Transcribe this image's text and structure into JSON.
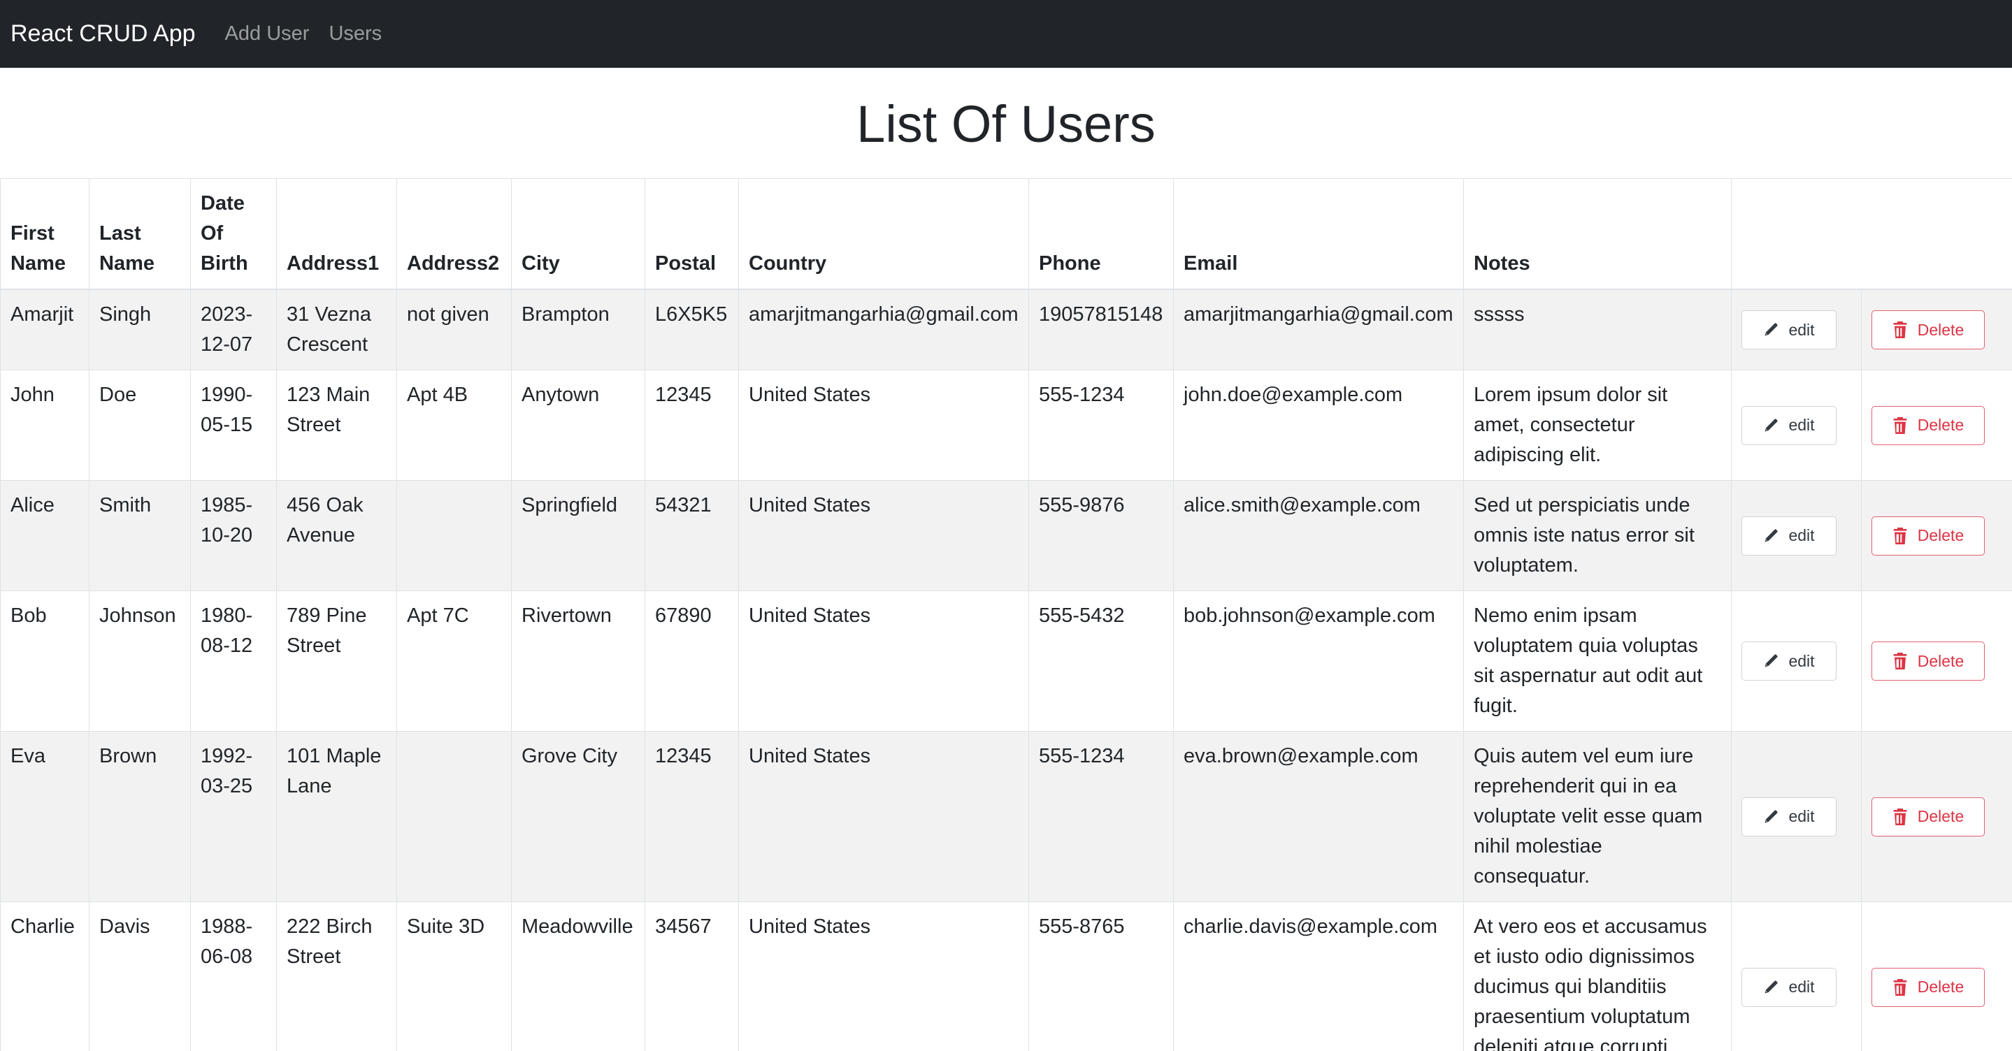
{
  "navbar": {
    "brand": "React CRUD App",
    "links": [
      "Add User",
      "Users"
    ]
  },
  "page": {
    "title": "List Of Users"
  },
  "table": {
    "headers": [
      "First Name",
      "Last Name",
      "Date Of Birth",
      "Address1",
      "Address2",
      "City",
      "Postal",
      "Country",
      "Phone",
      "Email",
      "Notes",
      ""
    ],
    "edit_label": "edit",
    "delete_label": "Delete",
    "rows": [
      {
        "first": "Amarjit",
        "last": "Singh",
        "dob": "2023-12-07",
        "address1": "31 Vezna Crescent",
        "address2": "not given",
        "city": "Brampton",
        "postal": "L6X5K5",
        "country": "amarjitmangarhia@gmail.com",
        "phone": "19057815148",
        "email": "amarjitmangarhia@gmail.com",
        "notes": "sssss"
      },
      {
        "first": "John",
        "last": "Doe",
        "dob": "1990-05-15",
        "address1": "123 Main Street",
        "address2": "Apt 4B",
        "city": "Anytown",
        "postal": "12345",
        "country": "United States",
        "phone": "555-1234",
        "email": "john.doe@example.com",
        "notes": "Lorem ipsum dolor sit amet, consectetur adipiscing elit."
      },
      {
        "first": "Alice",
        "last": "Smith",
        "dob": "1985-10-20",
        "address1": "456 Oak Avenue",
        "address2": "",
        "city": "Springfield",
        "postal": "54321",
        "country": "United States",
        "phone": "555-9876",
        "email": "alice.smith@example.com",
        "notes": "Sed ut perspiciatis unde omnis iste natus error sit voluptatem."
      },
      {
        "first": "Bob",
        "last": "Johnson",
        "dob": "1980-08-12",
        "address1": "789 Pine Street",
        "address2": "Apt 7C",
        "city": "Rivertown",
        "postal": "67890",
        "country": "United States",
        "phone": "555-5432",
        "email": "bob.johnson@example.com",
        "notes": "Nemo enim ipsam voluptatem quia voluptas sit aspernatur aut odit aut fugit."
      },
      {
        "first": "Eva",
        "last": "Brown",
        "dob": "1992-03-25",
        "address1": "101 Maple Lane",
        "address2": "",
        "city": "Grove City",
        "postal": "12345",
        "country": "United States",
        "phone": "555-1234",
        "email": "eva.brown@example.com",
        "notes": "Quis autem vel eum iure reprehenderit qui in ea voluptate velit esse quam nihil molestiae consequatur."
      },
      {
        "first": "Charlie",
        "last": "Davis",
        "dob": "1988-06-08",
        "address1": "222 Birch Street",
        "address2": "Suite 3D",
        "city": "Meadowville",
        "postal": "34567",
        "country": "United States",
        "phone": "555-8765",
        "email": "charlie.davis@example.com",
        "notes": "At vero eos et accusamus et iusto odio dignissimos ducimus qui blanditiis praesentium voluptatum deleniti atque corrupti"
      }
    ]
  },
  "icons": {
    "edit": "pencil-icon",
    "delete": "trash-icon"
  },
  "colors": {
    "navbar_bg": "#212529",
    "delete_red": "#dc3545",
    "stripe": "#f2f2f2"
  }
}
